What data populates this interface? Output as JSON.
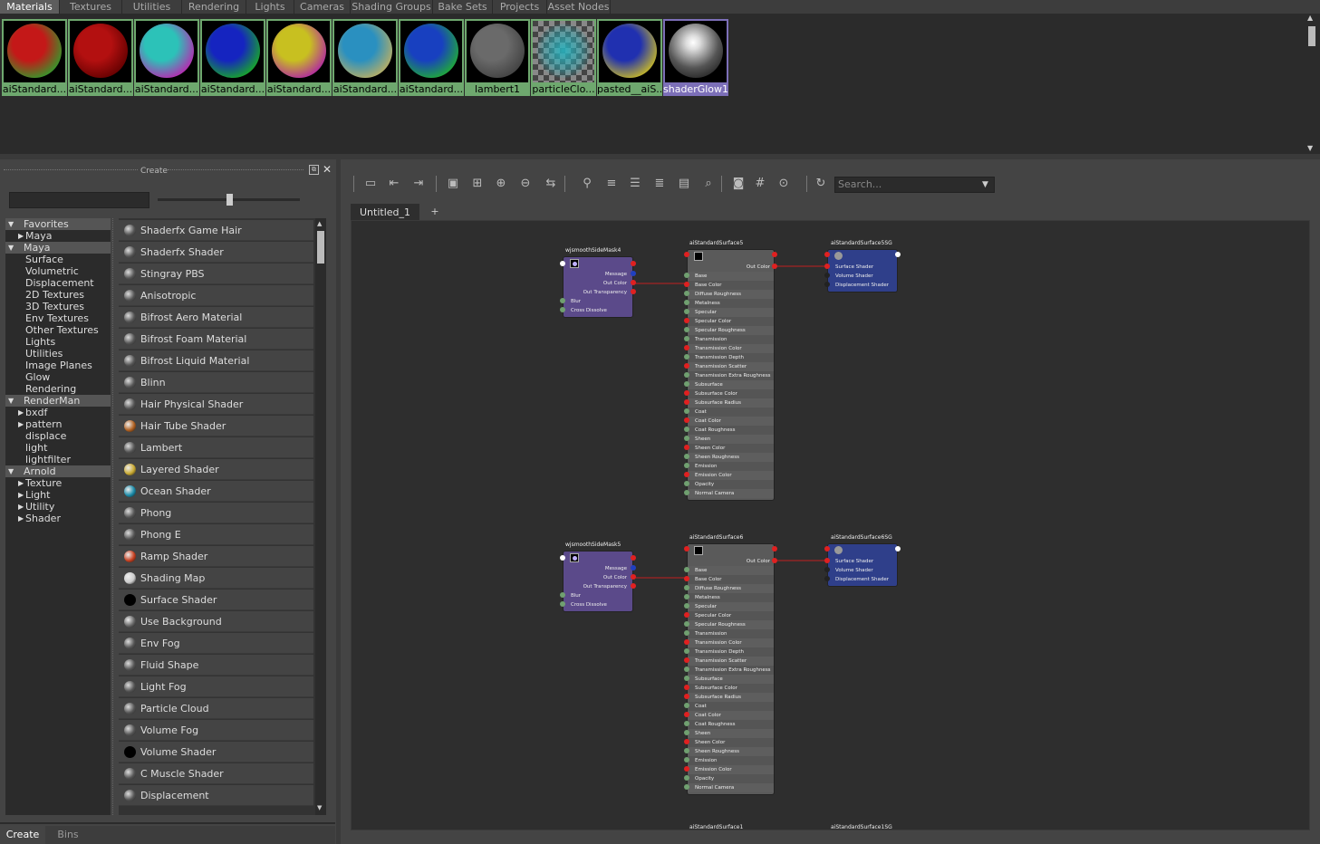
{
  "browser_tabs": [
    "Materials",
    "Textures",
    "Utilities",
    "Rendering",
    "Lights",
    "Cameras",
    "Shading Groups",
    "Bake Sets",
    "Projects",
    "Asset Nodes"
  ],
  "swatches": [
    {
      "label": "aiStandard...",
      "color": "#c41818",
      "rim": "#2da02d"
    },
    {
      "label": "aiStandard...",
      "color": "#b31010",
      "rim": "#600000"
    },
    {
      "label": "aiStandard...",
      "color": "#2cc2b8",
      "rim": "#c020b0"
    },
    {
      "label": "aiStandard...",
      "color": "#1524c0",
      "rim": "#18b020"
    },
    {
      "label": "aiStandard...",
      "color": "#c8c020",
      "rim": "#b020a8"
    },
    {
      "label": "aiStandard...",
      "color": "#2a90c0",
      "rim": "#c0b060"
    },
    {
      "label": "aiStandard...",
      "color": "#1840c0",
      "rim": "#20b030"
    },
    {
      "label": "lambert1",
      "color": "#6a6a6a",
      "rim": "#404040"
    },
    {
      "label": "particleClo...",
      "color": "#28b4c0",
      "rim": "#707070"
    },
    {
      "label": "pasted__aiS...",
      "color": "#2030b0",
      "rim": "#d0c020"
    },
    {
      "label": "shaderGlow1",
      "color": "#f0f0f0",
      "rim": "#303030"
    }
  ],
  "create_panel": {
    "title": "Create",
    "search_value": ""
  },
  "tree": [
    {
      "label": "Favorites",
      "level": 0,
      "header": true,
      "state": "open"
    },
    {
      "label": "Maya",
      "level": 1,
      "header": false,
      "state": "closed"
    },
    {
      "label": "Maya",
      "level": 0,
      "header": true,
      "state": "open"
    },
    {
      "label": "Surface",
      "level": 2,
      "header": false,
      "state": ""
    },
    {
      "label": "Volumetric",
      "level": 2,
      "header": false,
      "state": ""
    },
    {
      "label": "Displacement",
      "level": 2,
      "header": false,
      "state": ""
    },
    {
      "label": "2D Textures",
      "level": 2,
      "header": false,
      "state": ""
    },
    {
      "label": "3D Textures",
      "level": 2,
      "header": false,
      "state": ""
    },
    {
      "label": "Env Textures",
      "level": 2,
      "header": false,
      "state": ""
    },
    {
      "label": "Other Textures",
      "level": 2,
      "header": false,
      "state": ""
    },
    {
      "label": "Lights",
      "level": 2,
      "header": false,
      "state": ""
    },
    {
      "label": "Utilities",
      "level": 2,
      "header": false,
      "state": ""
    },
    {
      "label": "Image Planes",
      "level": 2,
      "header": false,
      "state": ""
    },
    {
      "label": "Glow",
      "level": 2,
      "header": false,
      "state": ""
    },
    {
      "label": "Rendering",
      "level": 2,
      "header": false,
      "state": ""
    },
    {
      "label": "RenderMan",
      "level": 0,
      "header": true,
      "state": "open"
    },
    {
      "label": "bxdf",
      "level": 1,
      "header": false,
      "state": "closed"
    },
    {
      "label": "pattern",
      "level": 1,
      "header": false,
      "state": "closed"
    },
    {
      "label": "displace",
      "level": 2,
      "header": false,
      "state": ""
    },
    {
      "label": "light",
      "level": 2,
      "header": false,
      "state": ""
    },
    {
      "label": "lightfilter",
      "level": 2,
      "header": false,
      "state": ""
    },
    {
      "label": "Arnold",
      "level": 0,
      "header": true,
      "state": "open"
    },
    {
      "label": "Texture",
      "level": 1,
      "header": false,
      "state": "closed"
    },
    {
      "label": "Light",
      "level": 1,
      "header": false,
      "state": "closed"
    },
    {
      "label": "Utility",
      "level": 1,
      "header": false,
      "state": "closed"
    },
    {
      "label": "Shader",
      "level": 1,
      "header": false,
      "state": "closed"
    }
  ],
  "shader_list": [
    "Shaderfx Game Hair",
    "Shaderfx Shader",
    "Stingray PBS",
    "Anisotropic",
    "Bifrost Aero Material",
    "Bifrost Foam Material",
    "Bifrost Liquid Material",
    "Blinn",
    "Hair Physical Shader",
    "Hair Tube Shader",
    "Lambert",
    "Layered Shader",
    "Ocean Shader",
    "Phong",
    "Phong E",
    "Ramp Shader",
    "Shading Map",
    "Surface Shader",
    "Use Background",
    "Env Fog",
    "Fluid Shape",
    "Light Fog",
    "Particle Cloud",
    "Volume Fog",
    "Volume Shader",
    "C Muscle Shader",
    "Displacement"
  ],
  "bottom_tabs": [
    "Create",
    "Bins"
  ],
  "node_editor": {
    "search_placeholder": "Search...",
    "tab": "Untitled_1",
    "add_tab": "+",
    "toolbar_icons": [
      "frame-selected-icon",
      "input-connections-icon",
      "input-output-icon",
      "output-connections-icon",
      "graph-selected-icon",
      "add-selected-icon",
      "remove-selected-icon",
      "arrange-icon",
      "pin-icon",
      "simple-mode-icon",
      "connected-mode-icon",
      "full-mode-icon",
      "custom-mode-icon",
      "search-node-icon",
      "swatch-toggle-icon",
      "grid-icon",
      "snap-icon",
      "sync-icon",
      "settings-icon"
    ]
  },
  "nodes": {
    "mask_rows": [
      "Message",
      "Out Color",
      "Out Transparency",
      "Blur",
      "Cross Dissolve"
    ],
    "surface_rows": [
      "Base",
      "Base Color",
      "Diffuse Roughness",
      "Metalness",
      "Specular",
      "Specular Color",
      "Specular Roughness",
      "Transmission",
      "Transmission Color",
      "Transmission Depth",
      "Transmission Scatter",
      "Transmission Extra Roughness",
      "Subsurface",
      "Subsurface Color",
      "Subsurface Radius",
      "Coat",
      "Coat Color",
      "Coat Roughness",
      "Sheen",
      "Sheen Color",
      "Sheen Roughness",
      "Emission",
      "Emission Color",
      "Opacity",
      "Normal Camera"
    ],
    "sg_rows": [
      "Surface Shader",
      "Volume Shader",
      "Displacement Shader"
    ],
    "out_color": "Out Color",
    "group1": {
      "mask": "wjsmoothSideMask4",
      "surface": "aiStandardSurface5",
      "sg": "aiStandardSurface5SG"
    },
    "group2": {
      "mask": "wjsmoothSideMask5",
      "surface": "aiStandardSurface6",
      "sg": "aiStandardSurface6SG"
    },
    "group3": {
      "surface": "aiStandardSurface1",
      "sg": "aiStandardSurface1SG"
    }
  }
}
